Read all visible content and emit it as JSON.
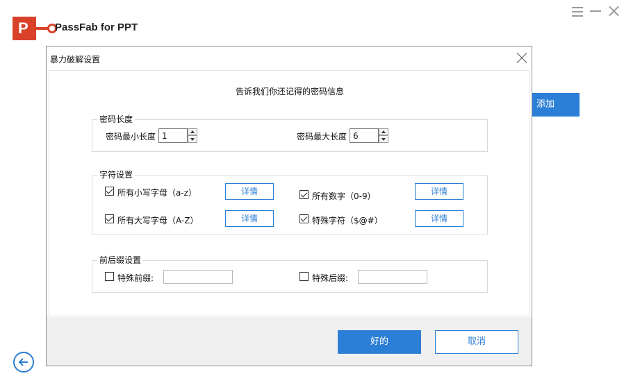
{
  "app": {
    "logo_letter": "P",
    "title": "PassFab for PPT",
    "add_label": "添加"
  },
  "dialog": {
    "title": "暴力破解设置",
    "heading": "告诉我们你还记得的密码信息",
    "length_group": {
      "legend": "密码长度",
      "min_label": "密码最小长度",
      "min_value": "1",
      "max_label": "密码最大长度",
      "max_value": "6"
    },
    "charset_group": {
      "legend": "字符设置",
      "lowercase": {
        "label": "所有小写字母（a-z）",
        "checked": true
      },
      "digits": {
        "label": "所有数字（0-9）",
        "checked": true
      },
      "uppercase": {
        "label": "所有大写字母（A-Z）",
        "checked": true
      },
      "special": {
        "label": "特殊字符（$@#）",
        "checked": true
      },
      "detail_label": "详情"
    },
    "affix_group": {
      "legend": "前后缀设置",
      "prefix_label": "特殊前缀:",
      "prefix_value": "",
      "suffix_label": "特殊后缀:",
      "suffix_value": ""
    },
    "ok_label": "好的",
    "cancel_label": "取消"
  },
  "colors": {
    "accent": "#2c7fd6",
    "brand": "#d9412a"
  }
}
